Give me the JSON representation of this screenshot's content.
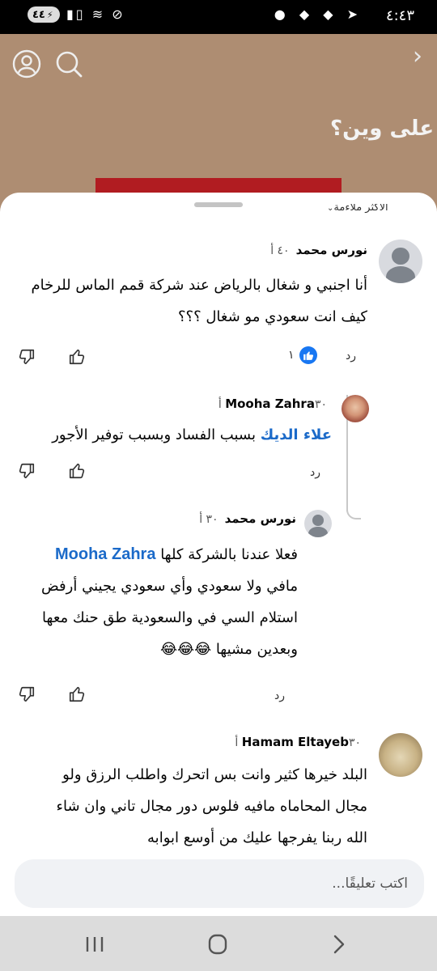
{
  "status_bar": {
    "battery": "٤٤",
    "time": "٤:٤٣"
  },
  "video": {
    "logo_text": "على وين؟"
  },
  "sheet": {
    "sort_label": "الأكثر ملاءمة"
  },
  "comments": [
    {
      "author": "نورس محمد",
      "time": "٤٠ أ",
      "lines": [
        "أنا اجنبي و شغال بالرياض عند شركة قمم الماس للرخام",
        "كيف انت سعودي مو شغال ؟؟؟"
      ],
      "reply_label": "رد",
      "reaction_count": "١"
    },
    {
      "author": "Mooha Zahra",
      "time": "٣٠ أ",
      "mention": "علاء الديك",
      "lines": [
        "بسبب الفساد وبسبب توفير الأجور"
      ],
      "reply_label": "رد"
    },
    {
      "author": "نورس محمد",
      "time": "٣٠ أ",
      "mention": "Mooha Zahra",
      "lines": [
        "فعلا عندنا بالشركة كلها",
        "مافي ولا سعودي وأي سعودي يجيني أرفض",
        "استلام السي في والسعودية طق حنك معها",
        "وبعدين مشيها 😂😂😂"
      ],
      "reply_label": "رد"
    },
    {
      "author": "Hamam Eltayeb",
      "time": "٣٠ أ",
      "lines": [
        "البلد خيرها كثير وانت بس اتحرك واطلب الرزق ولو",
        "مجال المحاماه مافيه فلوس دور مجال تاني وان شاء",
        "الله ربنا يفرجها عليك من أوسع ابوابه"
      ]
    }
  ],
  "composer": {
    "placeholder": "اكتب تعليقًا..."
  },
  "colors": {
    "accent": "#1877f2",
    "mention": "#1b6ac9",
    "video_bg": "#ae8d72"
  }
}
